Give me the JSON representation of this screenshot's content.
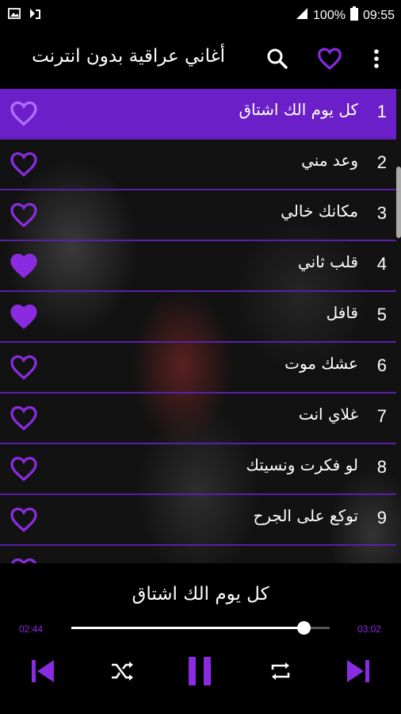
{
  "status_bar": {
    "battery": "100%",
    "time": "09:55"
  },
  "app_bar": {
    "title": "أغاني عراقية بدون انترنت"
  },
  "songs": [
    {
      "num": "1",
      "title": "كل يوم الك اشتاق",
      "favorite": false
    },
    {
      "num": "2",
      "title": "وعد مني",
      "favorite": false
    },
    {
      "num": "3",
      "title": "مكانك خالي",
      "favorite": false
    },
    {
      "num": "4",
      "title": "قلب ثاني",
      "favorite": true
    },
    {
      "num": "5",
      "title": "قافل",
      "favorite": true
    },
    {
      "num": "6",
      "title": "عشك موت",
      "favorite": false
    },
    {
      "num": "7",
      "title": "غلاي انت",
      "favorite": false
    },
    {
      "num": "8",
      "title": "لو فكرت ونسيتك",
      "favorite": false
    },
    {
      "num": "9",
      "title": "توكع على الجرح",
      "favorite": false
    }
  ],
  "player": {
    "now_playing": "كل يوم الك اشتاق",
    "elapsed": "02:44",
    "duration": "03:02",
    "progress": 0.9
  },
  "colors": {
    "accent": "#8a2be2",
    "active_row": "#6b1fc9"
  },
  "icons": [
    "image-icon",
    "download-icon",
    "signal-icon",
    "battery-icon",
    "search-icon",
    "heart-icon",
    "more-icon",
    "previous-icon",
    "shuffle-icon",
    "pause-icon",
    "repeat-icon",
    "next-icon"
  ]
}
